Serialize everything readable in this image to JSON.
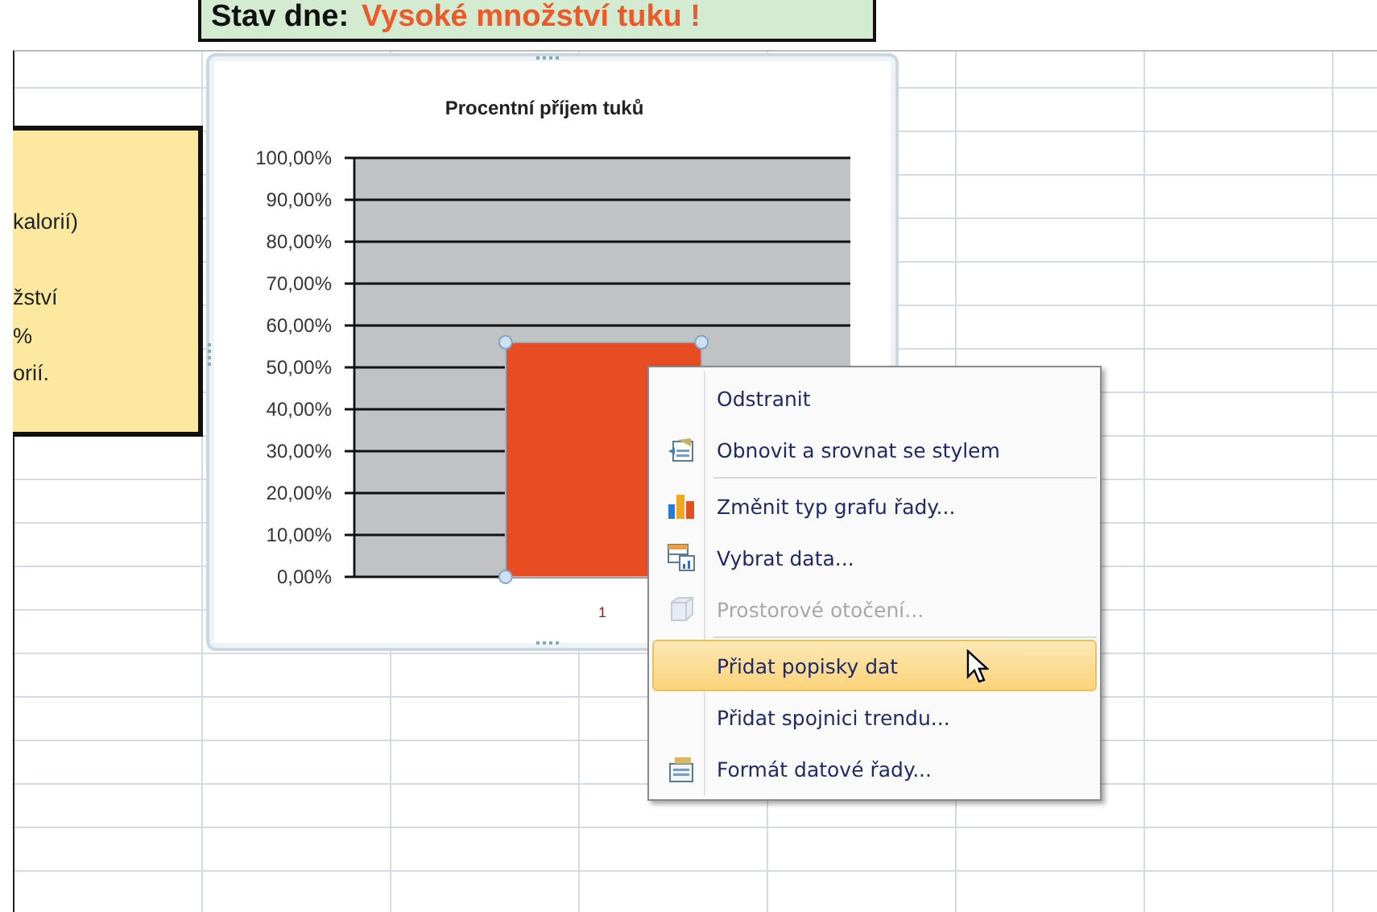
{
  "banner": {
    "label": "Stav dne:",
    "value": "Vysoké množství tuku !"
  },
  "note_box": {
    "paragraphs": [
      [
        "kalorií)"
      ],
      [
        "žství",
        "%",
        "orií."
      ]
    ]
  },
  "chart": {
    "chart_data": {
      "type": "bar",
      "title": "Procentní příjem tuků",
      "categories": [
        "1"
      ],
      "series": [
        {
          "color": "#e84c22",
          "values": [
            0.56
          ]
        }
      ],
      "ylim": [
        0,
        1
      ],
      "grid": true,
      "yticks": [
        {
          "value": 0,
          "label": "0,00%"
        },
        {
          "value": 0.1,
          "label": "10,00%"
        },
        {
          "value": 0.2,
          "label": "20,00%"
        },
        {
          "value": 0.3,
          "label": "30,00%"
        },
        {
          "value": 0.4,
          "label": "40,00%"
        },
        {
          "value": 0.5,
          "label": "50,00%"
        },
        {
          "value": 0.6,
          "label": "60,00%"
        },
        {
          "value": 0.7,
          "label": "70,00%"
        },
        {
          "value": 0.8,
          "label": "80,00%"
        },
        {
          "value": 0.9,
          "label": "90,00%"
        },
        {
          "value": 1,
          "label": "100,00%"
        }
      ]
    },
    "series_selected": true
  },
  "context_menu": {
    "items": [
      {
        "label": "Odstranit",
        "disabled": false,
        "selected": false,
        "separator_after": false
      },
      {
        "label": "Obnovit a srovnat se stylem",
        "disabled": false,
        "selected": false,
        "separator_after": true
      },
      {
        "label": "Změnit typ grafu řady...",
        "disabled": false,
        "selected": false,
        "separator_after": false
      },
      {
        "label": "Vybrat data...",
        "disabled": false,
        "selected": false,
        "separator_after": false
      },
      {
        "label": "Prostorové otočení...",
        "disabled": true,
        "selected": false,
        "separator_after": true
      },
      {
        "label": "Přidat popisky dat",
        "disabled": false,
        "selected": true,
        "separator_after": false
      },
      {
        "label": "Přidat spojnici trendu...",
        "disabled": false,
        "selected": false,
        "separator_after": false
      },
      {
        "label": "Formát datové řady...",
        "disabled": false,
        "selected": false,
        "separator_after": false
      }
    ]
  }
}
